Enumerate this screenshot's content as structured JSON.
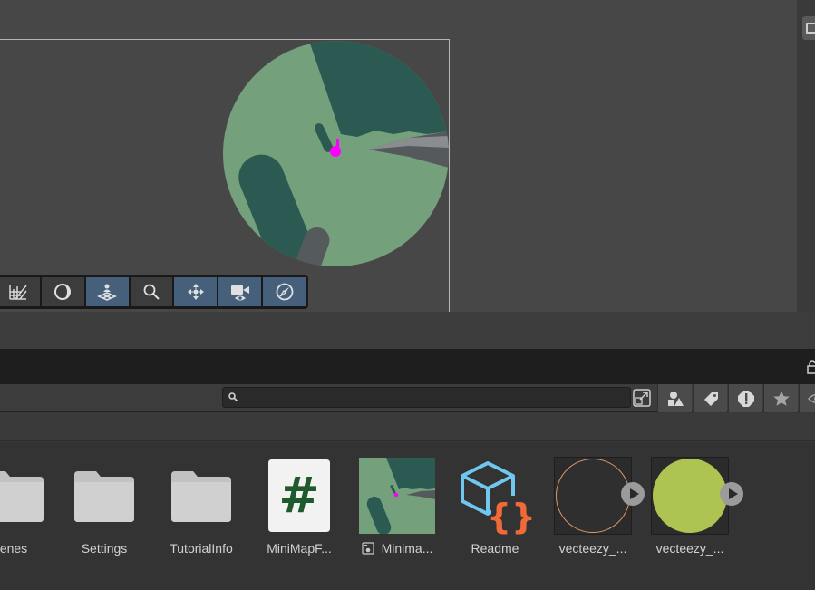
{
  "scene": {
    "toolbar": [
      {
        "name": "grid-snap-icon",
        "active": false
      },
      {
        "name": "lighting-icon",
        "active": false
      },
      {
        "name": "gizmo-plane-icon",
        "active": true
      },
      {
        "name": "search-icon",
        "active": false
      },
      {
        "name": "pivot-center-icon",
        "active": true
      },
      {
        "name": "scene-camera-icon",
        "active": true
      },
      {
        "name": "compass-icon",
        "active": true
      }
    ],
    "minimap_colors": {
      "ground": "#74a07c",
      "shadow": "#2b5a52",
      "marker": "#ff00ff"
    }
  },
  "project": {
    "search": {
      "value": "",
      "placeholder": ""
    },
    "toolbar_icons": [
      "create-asset-icon",
      "label-tag-icon",
      "warning-icon",
      "favorite-star-icon",
      "visibility-icon"
    ],
    "assets": [
      {
        "label": "enes",
        "type": "folder"
      },
      {
        "label": "Settings",
        "type": "folder"
      },
      {
        "label": "TutorialInfo",
        "type": "folder"
      },
      {
        "label": "MiniMapF...",
        "type": "csharp-script",
        "glyph": "#"
      },
      {
        "label": "Minima...",
        "type": "render-texture"
      },
      {
        "label": "Readme",
        "type": "scriptable-object",
        "glyph": "{}"
      },
      {
        "label": "vecteezy_...",
        "type": "sprite",
        "color": "#2f2f2f"
      },
      {
        "label": "vecteezy_...",
        "type": "sprite",
        "color": "#adc452"
      }
    ]
  }
}
